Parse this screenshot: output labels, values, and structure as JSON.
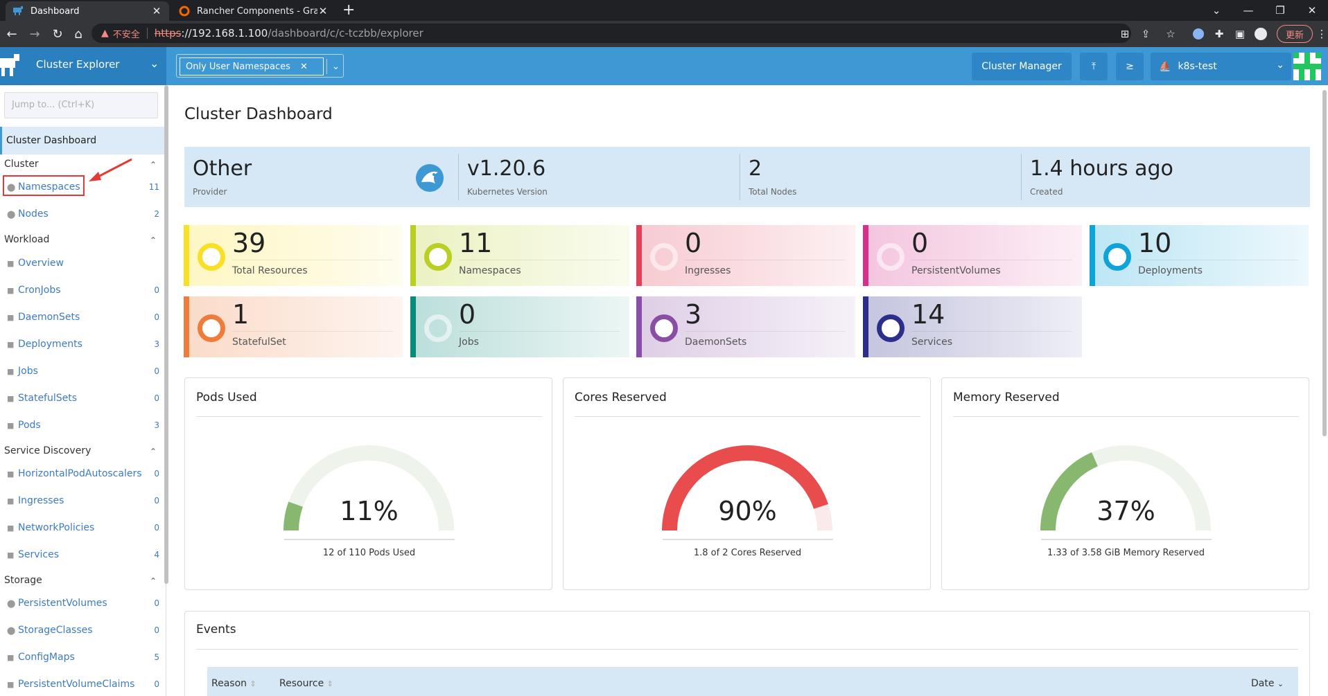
{
  "browser": {
    "tabs": [
      {
        "title": "Dashboard",
        "active": true
      },
      {
        "title": "Rancher Components - Grafana",
        "active": false
      }
    ],
    "address": {
      "insecure_label": "不安全",
      "scheme": "https",
      "host": "://192.168.1.100",
      "path": "/dashboard/c/c-tczbb/explorer"
    },
    "update_label": "更新"
  },
  "header": {
    "product": "Cluster Explorer",
    "namespace_filter": "Only User Namespaces",
    "cluster_manager": "Cluster Manager",
    "cluster_name": "k8s-test"
  },
  "sidebar": {
    "jump_placeholder": "Jump to... (Ctrl+K)",
    "active_item": "Cluster Dashboard",
    "groups": {
      "cluster": "Cluster",
      "workload": "Workload",
      "service_discovery": "Service Discovery",
      "storage": "Storage"
    },
    "items": [
      {
        "label": "Namespaces",
        "count": "11"
      },
      {
        "label": "Nodes",
        "count": "2"
      },
      {
        "label": "Overview",
        "count": ""
      },
      {
        "label": "CronJobs",
        "count": "0"
      },
      {
        "label": "DaemonSets",
        "count": "0"
      },
      {
        "label": "Deployments",
        "count": "3"
      },
      {
        "label": "Jobs",
        "count": "0"
      },
      {
        "label": "StatefulSets",
        "count": "0"
      },
      {
        "label": "Pods",
        "count": "3"
      },
      {
        "label": "HorizontalPodAutoscalers",
        "count": "0"
      },
      {
        "label": "Ingresses",
        "count": "0"
      },
      {
        "label": "NetworkPolicies",
        "count": "0"
      },
      {
        "label": "Services",
        "count": "4"
      },
      {
        "label": "PersistentVolumes",
        "count": "0"
      },
      {
        "label": "StorageClasses",
        "count": "0"
      },
      {
        "label": "ConfigMaps",
        "count": "5"
      },
      {
        "label": "PersistentVolumeClaims",
        "count": "0"
      }
    ]
  },
  "main": {
    "title": "Cluster Dashboard",
    "glance": [
      {
        "value": "Other",
        "label": "Provider"
      },
      {
        "value": "v1.20.6",
        "label": "Kubernetes Version"
      },
      {
        "value": "2",
        "label": "Total Nodes"
      },
      {
        "value": "1.4 hours ago",
        "label": "Created"
      }
    ],
    "cards": [
      {
        "value": "39",
        "label": "Total Resources",
        "color": "#f9e027"
      },
      {
        "value": "11",
        "label": "Namespaces",
        "color": "#b9cf23"
      },
      {
        "value": "0",
        "label": "Ingresses",
        "color": "#e0425b"
      },
      {
        "value": "0",
        "label": "PersistentVolumes",
        "color": "#d6308a"
      },
      {
        "value": "10",
        "label": "Deployments",
        "color": "#0fa4d8"
      },
      {
        "value": "1",
        "label": "StatefulSet",
        "color": "#ee7d3b"
      },
      {
        "value": "0",
        "label": "Jobs",
        "color": "#0a8a7c"
      },
      {
        "value": "3",
        "label": "DaemonSets",
        "color": "#8a4fa5"
      },
      {
        "value": "14",
        "label": "Services",
        "color": "#2b2e8a"
      }
    ],
    "gauges": [
      {
        "title": "Pods Used",
        "percent": "11%",
        "fraction": 0.11,
        "subtitle": "12 of 110 Pods Used"
      },
      {
        "title": "Cores Reserved",
        "percent": "90%",
        "fraction": 0.9,
        "subtitle": "1.8 of 2 Cores Reserved"
      },
      {
        "title": "Memory Reserved",
        "percent": "37%",
        "fraction": 0.37,
        "subtitle": "1.33 of 3.58 GiB Memory Reserved"
      }
    ],
    "events": {
      "title": "Events",
      "columns": [
        "Reason",
        "Resource",
        "Date"
      ]
    }
  }
}
